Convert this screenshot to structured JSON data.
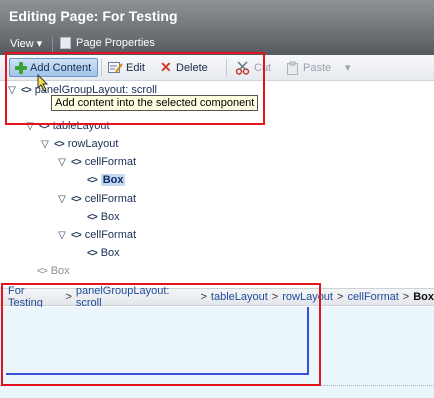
{
  "window": {
    "title": "Editing Page: For Testing"
  },
  "menubar": {
    "view_label": "View",
    "page_properties_label": "Page Properties"
  },
  "toolbar": {
    "add_content_label": "Add Content",
    "edit_label": "Edit",
    "delete_label": "Delete",
    "cut_label": "Cut",
    "paste_label": "Paste"
  },
  "tooltip": {
    "text": "Add content into the selected component"
  },
  "tree": {
    "root_label": "panelGroupLayout: scroll",
    "table_label": "tableLayout",
    "row_label": "rowLayout",
    "cell1_label": "cellFormat",
    "box1_label": "Box",
    "cell2_label": "cellFormat",
    "box2_label": "Box",
    "cell3_label": "cellFormat",
    "box3_label": "Box",
    "outer_box_label": "Box"
  },
  "breadcrumb": {
    "items": [
      "For Testing",
      "panelGroupLayout: scroll",
      "tableLayout",
      "rowLayout",
      "cellFormat"
    ],
    "separator": ">",
    "current": "Box"
  },
  "colors": {
    "highlight_red": "#e2141d",
    "frame_blue": "#3b4fd6",
    "canvas_bg": "#eaf6fb"
  }
}
